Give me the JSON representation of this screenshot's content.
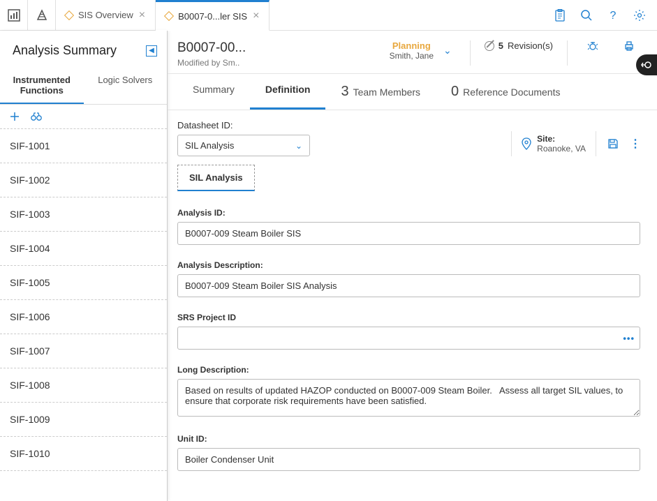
{
  "topbar": {
    "tabs": [
      {
        "label": "SIS Overview",
        "active": false
      },
      {
        "label": "B0007-0...ler SIS",
        "active": true
      }
    ]
  },
  "sidebar": {
    "title": "Analysis Summary",
    "tabs": {
      "instrumented": "Instrumented Functions",
      "logic": "Logic Solvers"
    },
    "items": [
      "SIF-1001",
      "SIF-1002",
      "SIF-1003",
      "SIF-1004",
      "SIF-1005",
      "SIF-1006",
      "SIF-1007",
      "SIF-1008",
      "SIF-1009",
      "SIF-1010"
    ]
  },
  "header": {
    "title": "B0007-00...",
    "subtitle": "Modified by Sm..",
    "status_label": "Planning",
    "status_name": "Smith, Jane",
    "revisions_count": "5",
    "revisions_label": "Revision(s)"
  },
  "content_tabs": {
    "summary": "Summary",
    "definition": "Definition",
    "team_count": "3",
    "team_label": "Team Members",
    "ref_count": "0",
    "ref_label": "Reference Documents"
  },
  "datasheet": {
    "label": "Datasheet ID:",
    "value": "SIL Analysis",
    "site_label": "Site:",
    "site_value": "Roanoke, VA",
    "sub_tab": "SIL Analysis"
  },
  "form": {
    "analysis_id_label": "Analysis ID:",
    "analysis_id_value": "B0007-009 Steam Boiler SIS",
    "analysis_desc_label": "Analysis Description:",
    "analysis_desc_value": "B0007-009 Steam Boiler SIS Analysis",
    "srs_label": "SRS Project ID",
    "srs_value": "",
    "long_desc_label": "Long Description:",
    "long_desc_value": "Based on results of updated HAZOP conducted on B0007-009 Steam Boiler.   Assess all target SIL values, to ensure that corporate risk requirements have been satisfied.",
    "unit_id_label": "Unit ID:",
    "unit_id_value": "Boiler Condenser Unit"
  }
}
